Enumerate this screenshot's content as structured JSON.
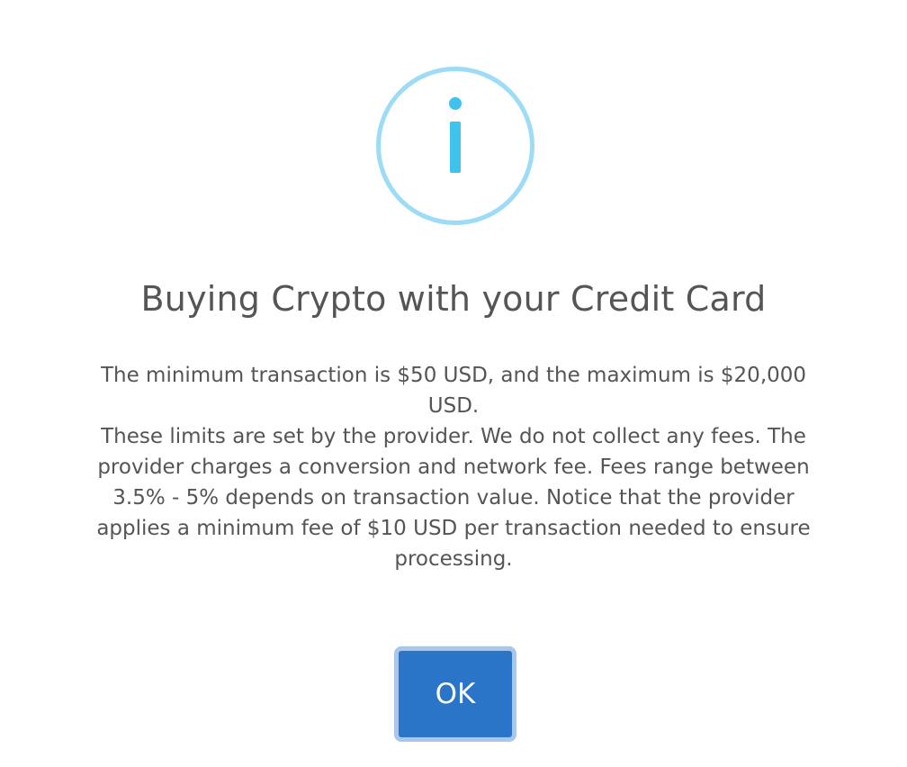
{
  "icon": {
    "name": "info-icon",
    "ring_color": "#9ddcf6",
    "glyph_color": "#3fc3ee"
  },
  "dialog": {
    "title": "Buying Crypto with your Credit Card",
    "message_line1": "The minimum transaction is $50 USD, and the maximum is $20,000 USD.",
    "message_line2": "These limits are set by the provider. We do not collect any fees. The provider charges a conversion and network fee. Fees range between 3.5% - 5% depends on transaction value. Notice that the provider applies a minimum fee of $10 USD per transaction needed to ensure processing.",
    "ok_label": "OK"
  },
  "colors": {
    "button_bg": "#2b75c9",
    "button_focus_ring": "#a8c7ea",
    "text": "#555555"
  }
}
